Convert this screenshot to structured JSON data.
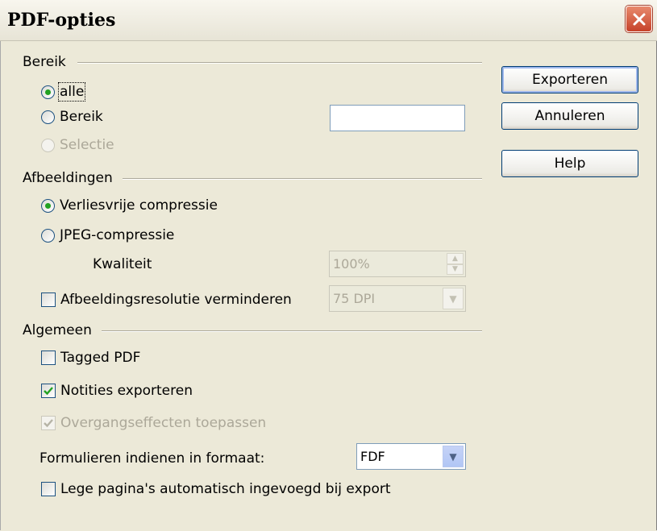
{
  "window": {
    "title": "PDF-opties"
  },
  "range": {
    "label": "Bereik",
    "all_label": "alle",
    "range_label": "Bereik",
    "range_value": "",
    "selection_label": "Selectie"
  },
  "images": {
    "label": "Afbeeldingen",
    "lossless_label": "Verliesvrije compressie",
    "jpeg_label": "JPEG-compressie",
    "quality_label": "Kwaliteit",
    "quality_value": "100%",
    "reduce_label": "Afbeeldingsresolutie verminderen",
    "reduce_value": "75 DPI"
  },
  "general": {
    "label": "Algemeen",
    "tagged_label": "Tagged PDF",
    "notes_label": "Notities exporteren",
    "transitions_label": "Overgangseffecten toepassen",
    "format_label": "Formulieren indienen in formaat:",
    "format_value": "FDF",
    "blank_pages_label": "Lege pagina's automatisch ingevoegd bij export"
  },
  "buttons": {
    "export": "Exporteren",
    "cancel": "Annuleren",
    "help": "Help"
  },
  "colors": {
    "title_close": "#c6422a",
    "radio_dot": "#21a121",
    "check_mark": "#21a121"
  }
}
